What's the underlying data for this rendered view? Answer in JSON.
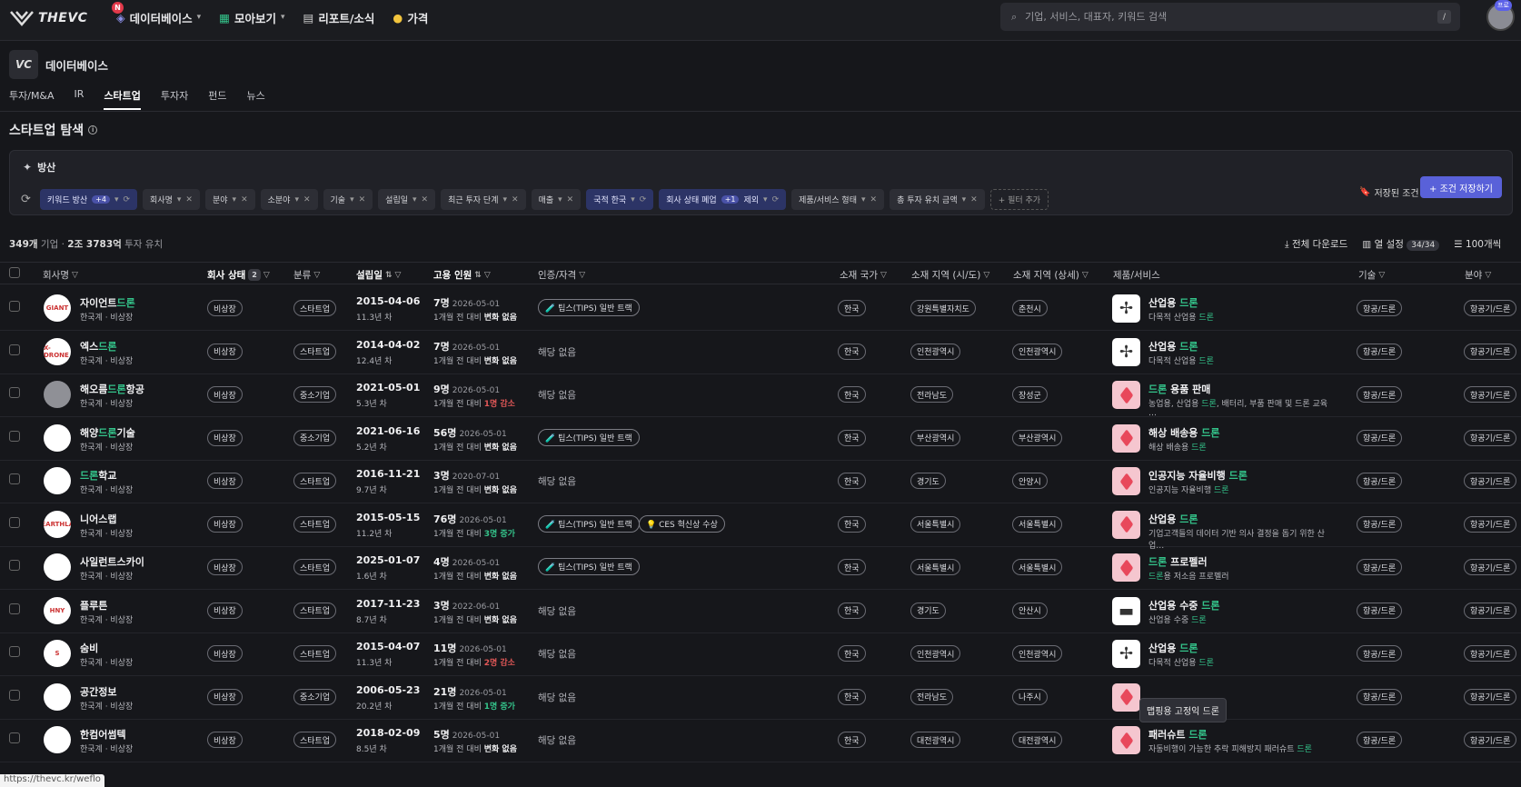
{
  "brand": {
    "name": "THEVC",
    "logo_icon": "thevc-logo-icon"
  },
  "nav": {
    "new_badge": "N",
    "items": [
      {
        "label": "데이터베이스",
        "icon": "database-icon"
      },
      {
        "label": "모아보기",
        "icon": "grid-icon"
      },
      {
        "label": "리포트/소식",
        "icon": "document-icon"
      },
      {
        "label": "가격",
        "icon": "coin-icon"
      }
    ]
  },
  "search": {
    "placeholder": "기업, 서비스, 대표자, 키워드 검색",
    "shortcut": "/"
  },
  "user": {
    "badge": "프로"
  },
  "section": {
    "logo": "VC",
    "title": "데이터베이스"
  },
  "tabs": [
    "투자/M&A",
    "IR",
    "스타트업",
    "투자자",
    "펀드",
    "뉴스"
  ],
  "active_tab": "스타트업",
  "page_title": "스타트업 탐색",
  "filter_panel": {
    "title": "방산",
    "chips": [
      {
        "label": "키워드 방산",
        "count": "+4",
        "active": true
      },
      {
        "label": "회사명",
        "active": false
      },
      {
        "label": "분야",
        "active": false
      },
      {
        "label": "소분야",
        "active": false
      },
      {
        "label": "기술",
        "active": false
      },
      {
        "label": "설립일",
        "active": false
      },
      {
        "label": "최근 투자 단계",
        "active": false
      },
      {
        "label": "매출",
        "active": false
      },
      {
        "label": "국적 한국",
        "active": true
      },
      {
        "label": "회사 상태 폐업",
        "count": "+1",
        "suffix": "제외",
        "active": true
      },
      {
        "label": "제품/서비스 형태",
        "active": false
      },
      {
        "label": "총 투자 유치 금액",
        "active": false
      }
    ],
    "add_filter": "+ 필터 추가",
    "saved_conditions": "저장된 조건",
    "save_button": "+ 조건 저장하기"
  },
  "summary": {
    "count": "349개",
    "count_label": "기업",
    "amount": "2조 3783억",
    "amount_label": "투자 유치"
  },
  "tools": {
    "download": "전체 다운로드",
    "columns": "열 설정",
    "columns_count": "34/34",
    "page_size": "100개씩"
  },
  "columns": [
    "회사명",
    "회사 상태",
    "분류",
    "설립일",
    "고용 인원",
    "인증/자격",
    "소재 국가",
    "소재 지역 (시/도)",
    "소재 지역 (상세)",
    "제품/서비스",
    "기술",
    "분야"
  ],
  "status_filter_count": "2",
  "rows": [
    {
      "name_pre": "자이언트",
      "name_hl": "드론",
      "name_post": "",
      "sub": "한국계 · 비상장",
      "status": "비상장",
      "type": "스타트업",
      "founded": "2015-04-06",
      "age": "11.3년 차",
      "employees": "7명",
      "emp_date": "2026-05-01",
      "change_pre": "1개월 전 대비 ",
      "change": "변화 없음",
      "change_kind": "none",
      "certs": [
        "🧪 팁스(TIPS) 일반 트랙"
      ],
      "country": "한국",
      "region": "강원특별자치도",
      "city": "춘천시",
      "prod_title_pre": "산업용 ",
      "prod_title_hl": "드론",
      "prod_title_post": "",
      "prod_sub_pre": "다목적 산업용 ",
      "prod_sub_hl": "드론",
      "prod_sub_post": "",
      "prod_img": "drone-icon",
      "tech": "항공/드론",
      "field": "항공기/드론",
      "logo": "GIANT"
    },
    {
      "name_pre": "엑스",
      "name_hl": "드론",
      "name_post": "",
      "sub": "한국계 · 비상장",
      "status": "비상장",
      "type": "스타트업",
      "founded": "2014-04-02",
      "age": "12.4년 차",
      "employees": "7명",
      "emp_date": "2026-05-01",
      "change_pre": "1개월 전 대비 ",
      "change": "변화 없음",
      "change_kind": "none",
      "certs": [],
      "country": "한국",
      "region": "인천광역시",
      "city": "인천광역시",
      "prod_title_pre": "산업용 ",
      "prod_title_hl": "드론",
      "prod_title_post": "",
      "prod_sub_pre": "다목적 산업용 ",
      "prod_sub_hl": "드론",
      "prod_sub_post": "",
      "prod_img": "drone-icon",
      "tech": "항공/드론",
      "field": "항공기/드론",
      "logo": "X-DRONE"
    },
    {
      "name_pre": "해오름",
      "name_hl": "드론",
      "name_post": "항공",
      "sub": "한국계 · 비상장",
      "status": "비상장",
      "type": "중소기업",
      "founded": "2021-05-01",
      "age": "5.3년 차",
      "employees": "9명",
      "emp_date": "2026-05-01",
      "change_pre": "1개월 전 대비 ",
      "change": "1명 감소",
      "change_kind": "down",
      "certs": [],
      "country": "한국",
      "region": "전라남도",
      "city": "장성군",
      "prod_title_pre": "",
      "prod_title_hl": "드론",
      "prod_title_post": " 용품 판매",
      "prod_sub_pre": "농업용, 산업용 ",
      "prod_sub_hl": "드론",
      "prod_sub_post": ", 배터리, 부품 판매 및 드론 교육 …",
      "prod_img": "cube-icon",
      "tech": "항공/드론",
      "field": "항공기/드론",
      "logo": ""
    },
    {
      "name_pre": "해양",
      "name_hl": "드론",
      "name_post": "기술",
      "sub": "한국계 · 비상장",
      "status": "비상장",
      "type": "중소기업",
      "founded": "2021-06-16",
      "age": "5.2년 차",
      "employees": "56명",
      "emp_date": "2026-05-01",
      "change_pre": "1개월 전 대비 ",
      "change": "변화 없음",
      "change_kind": "none",
      "certs": [
        "🧪 팁스(TIPS) 일반 트랙"
      ],
      "country": "한국",
      "region": "부산광역시",
      "city": "부산광역시",
      "prod_title_pre": "해상 배송용 ",
      "prod_title_hl": "드론",
      "prod_title_post": "",
      "prod_sub_pre": "해상 배송용 ",
      "prod_sub_hl": "드론",
      "prod_sub_post": "",
      "prod_img": "cube-icon",
      "tech": "항공/드론",
      "field": "항공기/드론",
      "logo": ""
    },
    {
      "name_pre": "",
      "name_hl": "드론",
      "name_post": "학교",
      "sub": "한국계 · 비상장",
      "status": "비상장",
      "type": "스타트업",
      "founded": "2016-11-21",
      "age": "9.7년 차",
      "employees": "3명",
      "emp_date": "2020-07-01",
      "change_pre": "1개월 전 대비 ",
      "change": "변화 없음",
      "change_kind": "none",
      "certs": [],
      "country": "한국",
      "region": "경기도",
      "city": "안양시",
      "prod_title_pre": "인공지능 자율비행 ",
      "prod_title_hl": "드론",
      "prod_title_post": "",
      "prod_sub_pre": "인공지능 자율비행 ",
      "prod_sub_hl": "드론",
      "prod_sub_post": "",
      "prod_img": "cube-icon",
      "tech": "항공/드론",
      "field": "항공기/드론",
      "logo": ""
    },
    {
      "name_pre": "니어스랩",
      "name_hl": "",
      "name_post": "",
      "sub": "한국계 · 비상장",
      "status": "비상장",
      "type": "스타트업",
      "founded": "2015-05-15",
      "age": "11.2년 차",
      "employees": "76명",
      "emp_date": "2026-05-01",
      "change_pre": "1개월 전 대비 ",
      "change": "3명 증가",
      "change_kind": "up",
      "certs": [
        "🧪 팁스(TIPS) 일반 트랙",
        "💡 CES 혁신상 수상"
      ],
      "country": "한국",
      "region": "서울특별시",
      "city": "서울특별시",
      "prod_title_pre": "산업용 ",
      "prod_title_hl": "드론",
      "prod_title_post": "",
      "prod_sub_pre": "기업고객들의 데이터 기반 의사 결정을 돕기 위한 산업…",
      "prod_sub_hl": "",
      "prod_sub_post": "",
      "prod_img": "cube-icon",
      "tech": "항공/드론",
      "field": "항공기/드론",
      "logo": "NEARTHLAB"
    },
    {
      "name_pre": "사일런트스카이",
      "name_hl": "",
      "name_post": "",
      "sub": "한국계 · 비상장",
      "status": "비상장",
      "type": "스타트업",
      "founded": "2025-01-07",
      "age": "1.6년 차",
      "employees": "4명",
      "emp_date": "2026-05-01",
      "change_pre": "1개월 전 대비 ",
      "change": "변화 없음",
      "change_kind": "none",
      "certs": [
        "🧪 팁스(TIPS) 일반 트랙"
      ],
      "country": "한국",
      "region": "서울특별시",
      "city": "서울특별시",
      "prod_title_pre": "",
      "prod_title_hl": "드론",
      "prod_title_post": " 프로펠러",
      "prod_sub_pre": "",
      "prod_sub_hl": "드론",
      "prod_sub_post": "용 저소음 프로펠러",
      "prod_img": "cube-icon",
      "tech": "항공/드론",
      "field": "항공기/드론",
      "logo": ""
    },
    {
      "name_pre": "플루튼",
      "name_hl": "",
      "name_post": "",
      "sub": "한국계 · 비상장",
      "status": "비상장",
      "type": "스타트업",
      "founded": "2017-11-23",
      "age": "8.7년 차",
      "employees": "3명",
      "emp_date": "2022-06-01",
      "change_pre": "1개월 전 대비 ",
      "change": "변화 없음",
      "change_kind": "none",
      "certs": [],
      "country": "한국",
      "region": "경기도",
      "city": "안산시",
      "prod_title_pre": "산업용 수중 ",
      "prod_title_hl": "드론",
      "prod_title_post": "",
      "prod_sub_pre": "산업용 수중 ",
      "prod_sub_hl": "드론",
      "prod_sub_post": "",
      "prod_img": "rov-icon",
      "tech": "항공/드론",
      "field": "항공기/드론",
      "logo": "HNY"
    },
    {
      "name_pre": "숨비",
      "name_hl": "",
      "name_post": "",
      "sub": "한국계 · 비상장",
      "status": "비상장",
      "type": "스타트업",
      "founded": "2015-04-07",
      "age": "11.3년 차",
      "employees": "11명",
      "emp_date": "2026-05-01",
      "change_pre": "1개월 전 대비 ",
      "change": "2명 감소",
      "change_kind": "down",
      "certs": [],
      "country": "한국",
      "region": "인천광역시",
      "city": "인천광역시",
      "prod_title_pre": "산업용 ",
      "prod_title_hl": "드론",
      "prod_title_post": "",
      "prod_sub_pre": "다목적 산업용 ",
      "prod_sub_hl": "드론",
      "prod_sub_post": "",
      "prod_img": "drone-icon",
      "tech": "항공/드론",
      "field": "항공기/드론",
      "logo": "S"
    },
    {
      "name_pre": "공간정보",
      "name_hl": "",
      "name_post": "",
      "sub": "한국계 · 비상장",
      "status": "비상장",
      "type": "중소기업",
      "founded": "2006-05-23",
      "age": "20.2년 차",
      "employees": "21명",
      "emp_date": "2026-05-01",
      "change_pre": "1개월 전 대비 ",
      "change": "1명 증가",
      "change_kind": "up",
      "certs": [],
      "country": "한국",
      "region": "전라남도",
      "city": "나주시",
      "prod_title_pre": "",
      "prod_title_hl": "",
      "prod_title_post": "",
      "prod_sub_pre": "맵핑용 고정익 ",
      "prod_sub_hl": "드론",
      "prod_sub_post": "",
      "prod_img": "cube-icon",
      "tech": "항공/드론",
      "field": "항공기/드론",
      "logo": ""
    },
    {
      "name_pre": "한컴어썸텍",
      "name_hl": "",
      "name_post": "",
      "sub": "한국계 · 비상장",
      "status": "비상장",
      "type": "스타트업",
      "founded": "2018-02-09",
      "age": "8.5년 차",
      "employees": "5명",
      "emp_date": "2026-05-01",
      "change_pre": "1개월 전 대비 ",
      "change": "변화 없음",
      "change_kind": "none",
      "certs": [],
      "country": "한국",
      "region": "대전광역시",
      "city": "대전광역시",
      "prod_title_pre": "패러슈트 ",
      "prod_title_hl": "드론",
      "prod_title_post": "",
      "prod_sub_pre": "자동비행이 가능한 추락 피해방지 패러슈트 ",
      "prod_sub_hl": "드론",
      "prod_sub_post": "",
      "prod_img": "cube-icon",
      "tech": "항공/드론",
      "field": "항공기/드론",
      "logo": ""
    }
  ],
  "none_text": "해당 없음",
  "tooltip": "맵핑용 고정익 드론",
  "status_url": "https://thevc.kr/weflo"
}
